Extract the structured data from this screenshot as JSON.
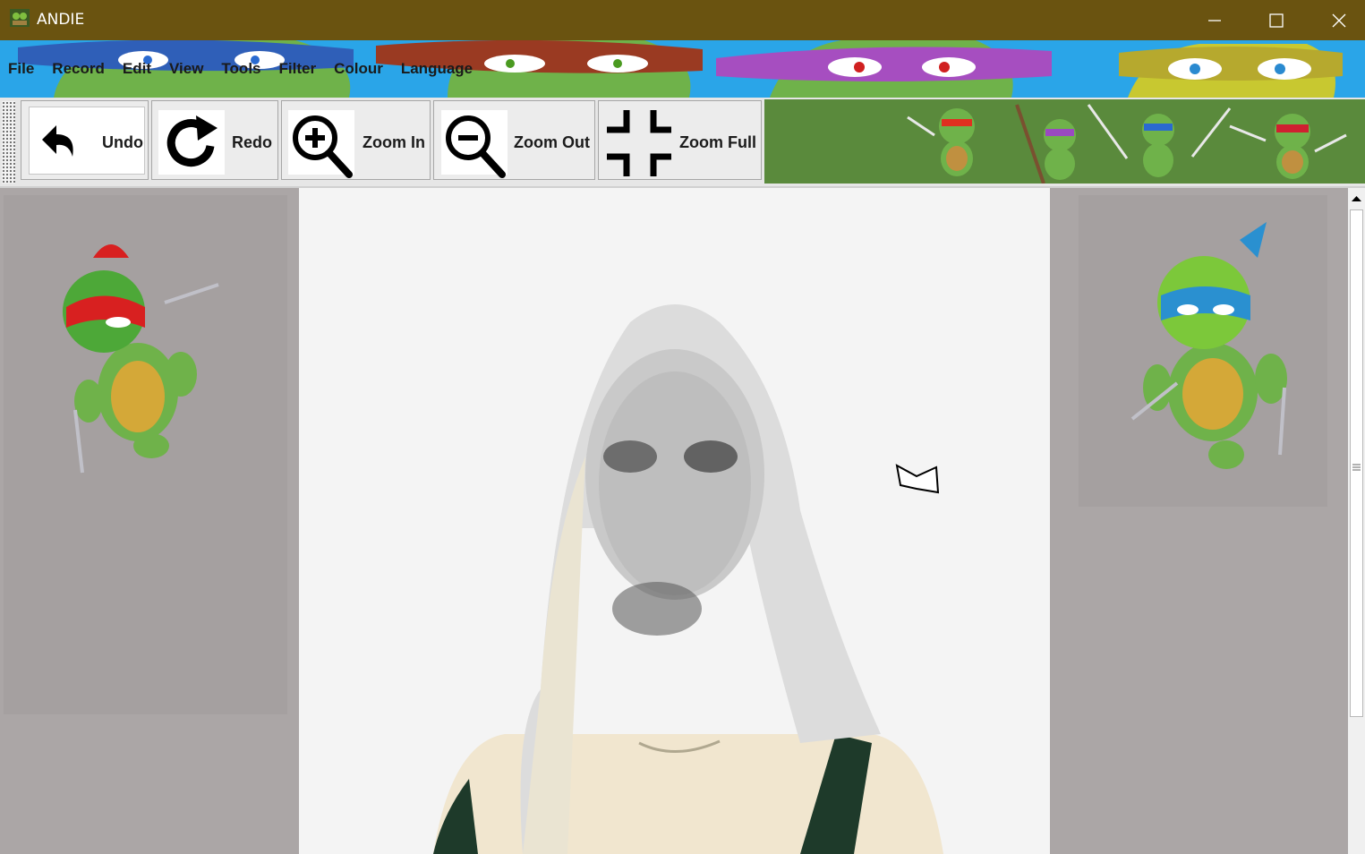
{
  "window": {
    "title": "ANDIE",
    "controls": [
      "minimize-icon",
      "maximize-icon",
      "close-icon"
    ]
  },
  "menu": {
    "items": [
      "File",
      "Record",
      "Edit",
      "View",
      "Tools",
      "Filter",
      "Colour",
      "Language"
    ]
  },
  "toolbar": {
    "undo_label": "Undo",
    "redo_label": "Redo",
    "zoom_in_label": "Zoom In",
    "zoom_out_label": "Zoom Out",
    "zoom_full_label": "Zoom Full",
    "icons": [
      "undo-icon",
      "redo-icon",
      "zoom-in-icon",
      "zoom-out-icon",
      "zoom-full-icon"
    ]
  },
  "colors": {
    "titlebar": "#6a5310",
    "menu_banner": "#2aa5e8",
    "toolbar_strip": "#5a8a3c",
    "side_panels": "#aba6a6"
  },
  "canvas": {
    "content": "edited photo"
  },
  "scrollbar": {
    "vertical_position": 0.0
  }
}
